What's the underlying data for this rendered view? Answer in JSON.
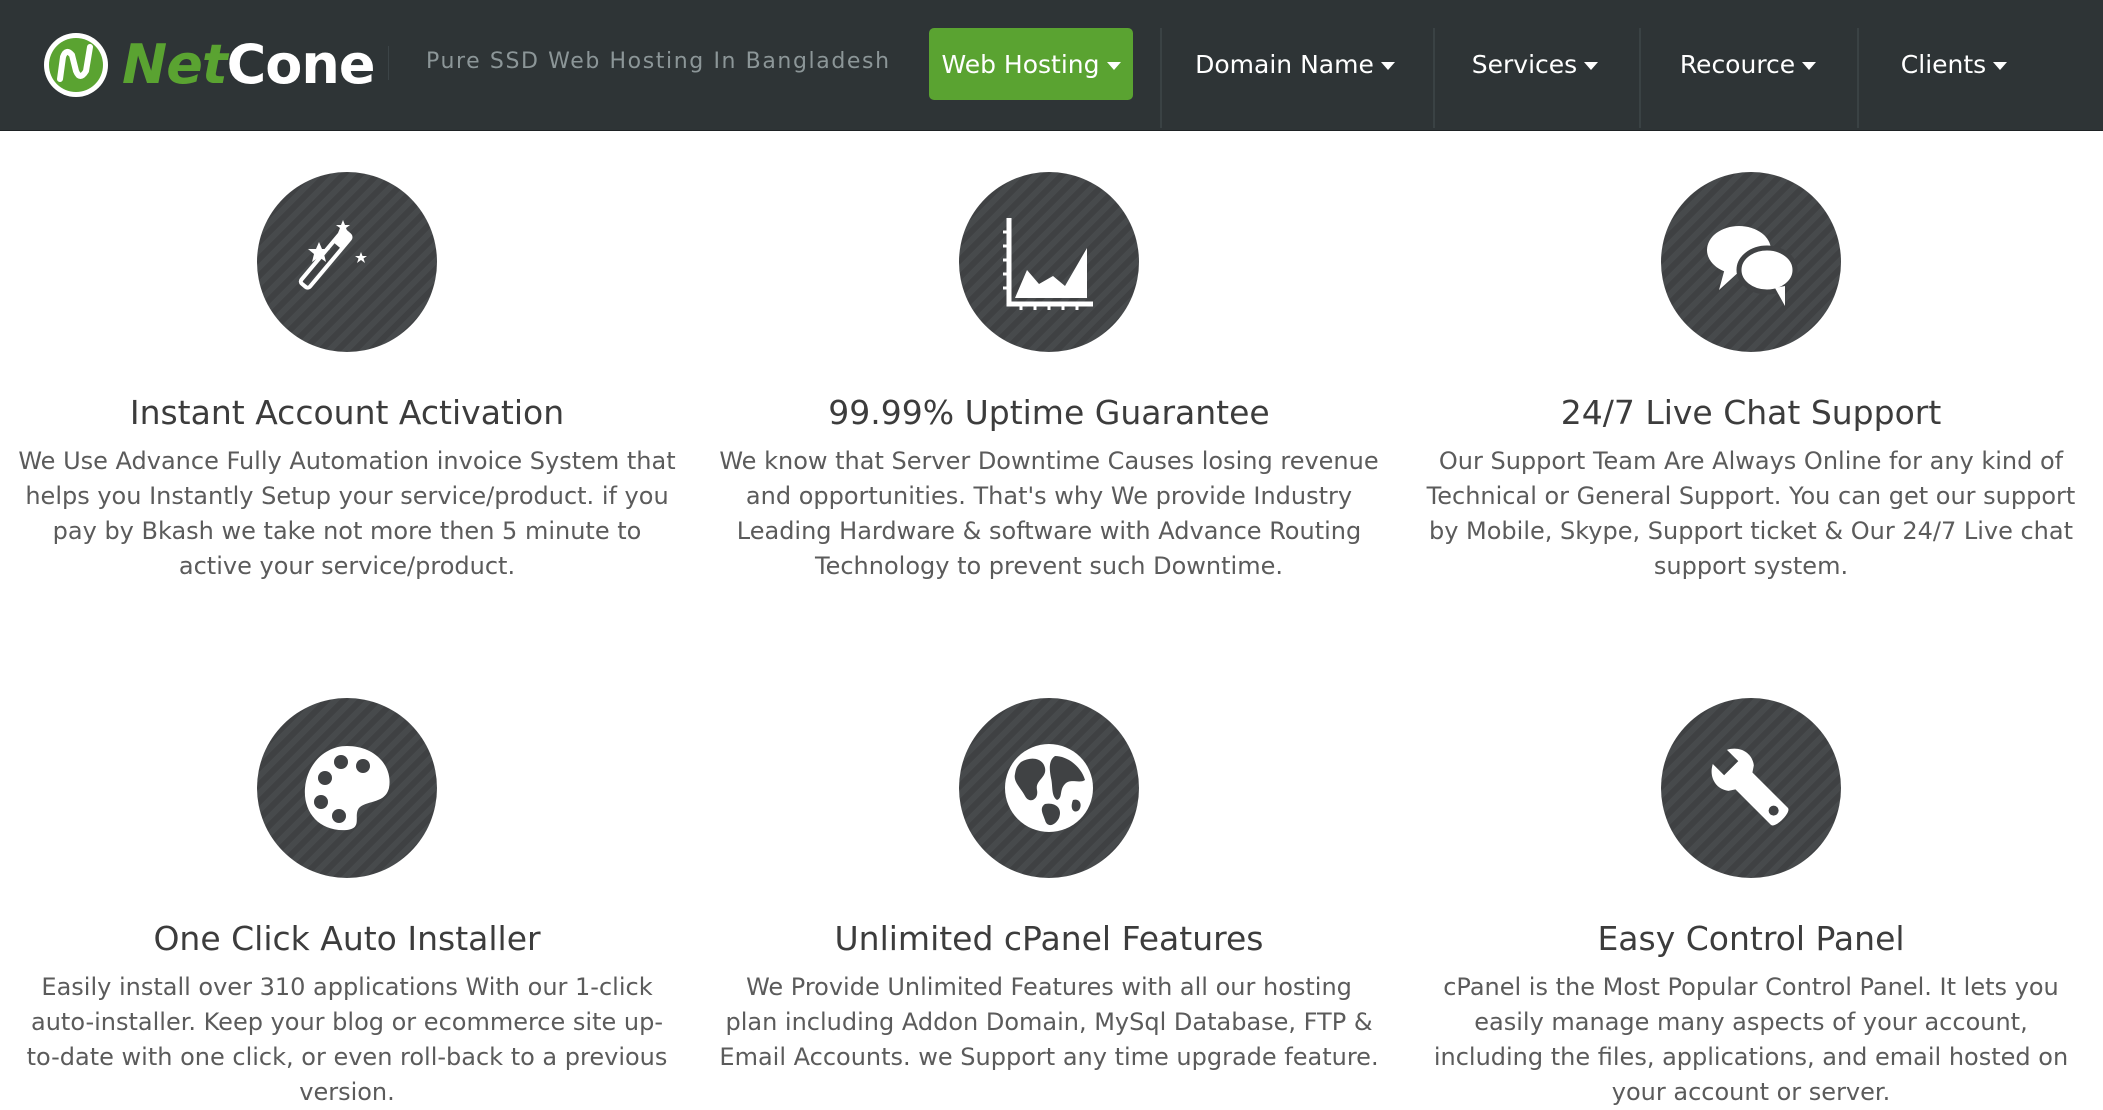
{
  "header": {
    "logo": {
      "part1": "Net",
      "part2": "Cone"
    },
    "tagline": "Pure SSD Web Hosting In Bangladesh",
    "nav": [
      {
        "label": "Web Hosting",
        "active": true
      },
      {
        "label": "Domain Name"
      },
      {
        "label": "Services"
      },
      {
        "label": "Recource"
      },
      {
        "label": "Clients"
      }
    ]
  },
  "features": [
    {
      "icon": "magic-wand-icon",
      "title": "Instant Account Activation",
      "description": "We Use Advance Fully Automation invoice System that helps you Instantly Setup your service/product. if you pay by Bkash we take not more then 5 minute to active your service/product."
    },
    {
      "icon": "area-chart-icon",
      "title": "99.99% Uptime Guarantee",
      "description": "We know that Server Downtime Causes losing revenue and opportunities. That's why We provide Industry Leading Hardware & software with Advance Routing Technology to prevent such Downtime."
    },
    {
      "icon": "chat-bubbles-icon",
      "title": "24/7 Live Chat Support",
      "description": "Our Support Team Are Always Online for any kind of Technical or General Support. You can get our support by Mobile, Skype, Support ticket & Our 24/7 Live chat support system."
    },
    {
      "icon": "paint-palette-icon",
      "title": "One Click Auto Installer",
      "description": "Easily install over 310 applications With our 1-click auto-installer. Keep your blog or ecommerce site up-to-date with one click, or even roll-back to a previous version."
    },
    {
      "icon": "globe-icon",
      "title": "Unlimited cPanel Features",
      "description": "We Provide Unlimited Features with all our hosting plan including Addon Domain, MySql Database, FTP & Email Accounts. we Support any time upgrade feature."
    },
    {
      "icon": "wrench-icon",
      "title": "Easy Control Panel",
      "description": "cPanel is the Most Popular Control Panel. It lets you easily manage many aspects of your account, including the files, applications, and email hosted on your account or server."
    }
  ],
  "colors": {
    "header_bg": "#2e3436",
    "accent": "#5aa331",
    "circle_bg": "#404244"
  }
}
